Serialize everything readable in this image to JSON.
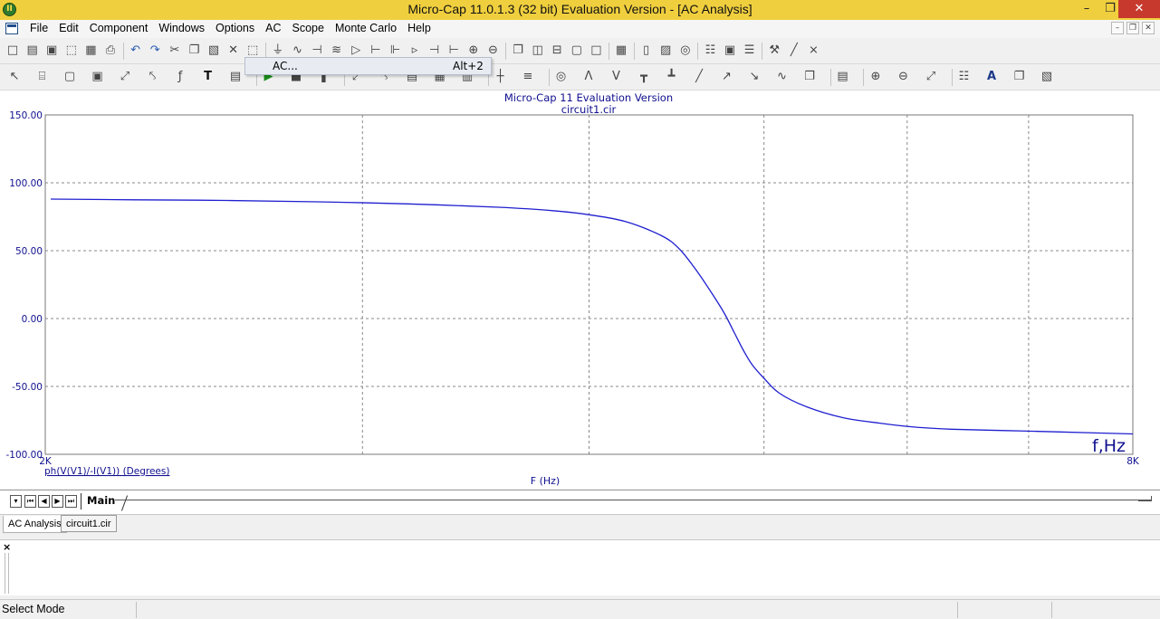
{
  "window": {
    "title": "Micro-Cap 11.0.1.3 (32 bit) Evaluation Version - [AC Analysis]",
    "app_icon_text": "II",
    "controls": [
      "minimize-icon",
      "restore-icon",
      "close-icon"
    ]
  },
  "menubar": {
    "items": [
      "File",
      "Edit",
      "Component",
      "Windows",
      "Options",
      "AC",
      "Scope",
      "Monte Carlo",
      "Help"
    ]
  },
  "toolbar1": {
    "icons": [
      "new-icon",
      "open-icon",
      "save-icon",
      "export-icon",
      "print-preview-icon",
      "print-icon",
      "undo-icon",
      "redo-icon",
      "cut-icon",
      "copy-icon",
      "paste-icon",
      "delete-icon",
      "select-area-icon",
      "ground-icon",
      "resistor-icon",
      "capacitor-icon",
      "inductor-icon",
      "diode-icon",
      "transistor-icon",
      "mosfet-icon",
      "opamp-icon",
      "battery-icon",
      "npn-icon",
      "voltage-source-icon",
      "current-source-icon",
      "cascade-icon",
      "tile-vertical-icon",
      "tile-horizontal-icon",
      "window-icon",
      "maximize-icon",
      "calculator-icon",
      "page-icon",
      "component-editor-icon",
      "globe-icon",
      "analysis-icon",
      "probe-icon",
      "parameters-icon",
      "tools-icon",
      "plot-icon",
      "stepping-icon"
    ]
  },
  "toolbar2": {
    "icons": [
      "select-mode-icon",
      "component-mode-icon",
      "window-icon",
      "graph-icon",
      "scale-icon",
      "zoom-box-icon",
      "formula-icon",
      "text-icon",
      "properties-icon",
      "run-icon",
      "stop-icon",
      "pause-icon",
      "cursor-icon",
      "points-icon",
      "labels-icon",
      "grid-icon",
      "minor-grid-icon",
      "axes-icon",
      "legend-icon",
      "scope-icon",
      "peak-icon",
      "valley-icon",
      "high-icon",
      "low-icon",
      "slope-icon",
      "rise-icon",
      "fall-icon",
      "inflection-icon",
      "copy-data-icon",
      "export-data-icon",
      "zoom-in-icon",
      "zoom-out-icon",
      "fit-icon",
      "layout-icon",
      "font-icon",
      "copy-icon",
      "paste-icon"
    ]
  },
  "dropdown": {
    "item_label": "AC...",
    "item_accel": "Alt+2"
  },
  "plot": {
    "title": "Micro-Cap 11 Evaluation Version",
    "subtitle": "circuit1.cir",
    "xlabel": "F (Hz)",
    "trace_label": "ph(V(V1)/-I(V1)) (Degrees)",
    "corner_label": "f,Hz",
    "trace_color": "#1f1fd0",
    "axis_color": "#101090"
  },
  "chart_data": {
    "type": "line",
    "xlabel": "F (Hz)",
    "ylabel": "ph(V(V1)/-I(V1)) (Degrees)",
    "xscale": "linear",
    "xlim": [
      2000,
      8000
    ],
    "ylim": [
      -100,
      150
    ],
    "x_tick_labels": [
      "2K",
      "8K"
    ],
    "y_ticks": [
      150,
      100,
      50,
      0,
      -50,
      -100
    ],
    "y_tick_labels": [
      "150.00",
      "100.00",
      "50.00",
      "0.00",
      "-50.00",
      "-100.00"
    ],
    "x_grid": [
      2000,
      3750,
      5000,
      5965,
      6755,
      7425,
      8000
    ],
    "grid": true,
    "series": [
      {
        "name": "ph(V(V1)/-I(V1)) (Degrees)",
        "x": [
          2030,
          2500,
          3000,
          3500,
          4000,
          4500,
          4800,
          5000,
          5200,
          5400,
          5500,
          5600,
          5700,
          5750,
          5800,
          5850,
          5900,
          5965,
          6050,
          6200,
          6400,
          6600,
          6800,
          7000,
          7300,
          7600,
          8000
        ],
        "y": [
          88,
          87.5,
          87,
          86,
          84.5,
          82,
          79.5,
          76.5,
          71.5,
          61,
          51,
          34,
          14,
          3,
          -10,
          -23,
          -34,
          -44,
          -55,
          -65,
          -73,
          -77,
          -80,
          -81.5,
          -82.5,
          -83.5,
          -85
        ]
      }
    ]
  },
  "tabs": {
    "page_tab": "Main",
    "doc_tabs": [
      "AC Analysis",
      "circuit1.cir"
    ]
  },
  "output": {
    "close_glyph": "×"
  },
  "status": {
    "text": "Select Mode"
  }
}
